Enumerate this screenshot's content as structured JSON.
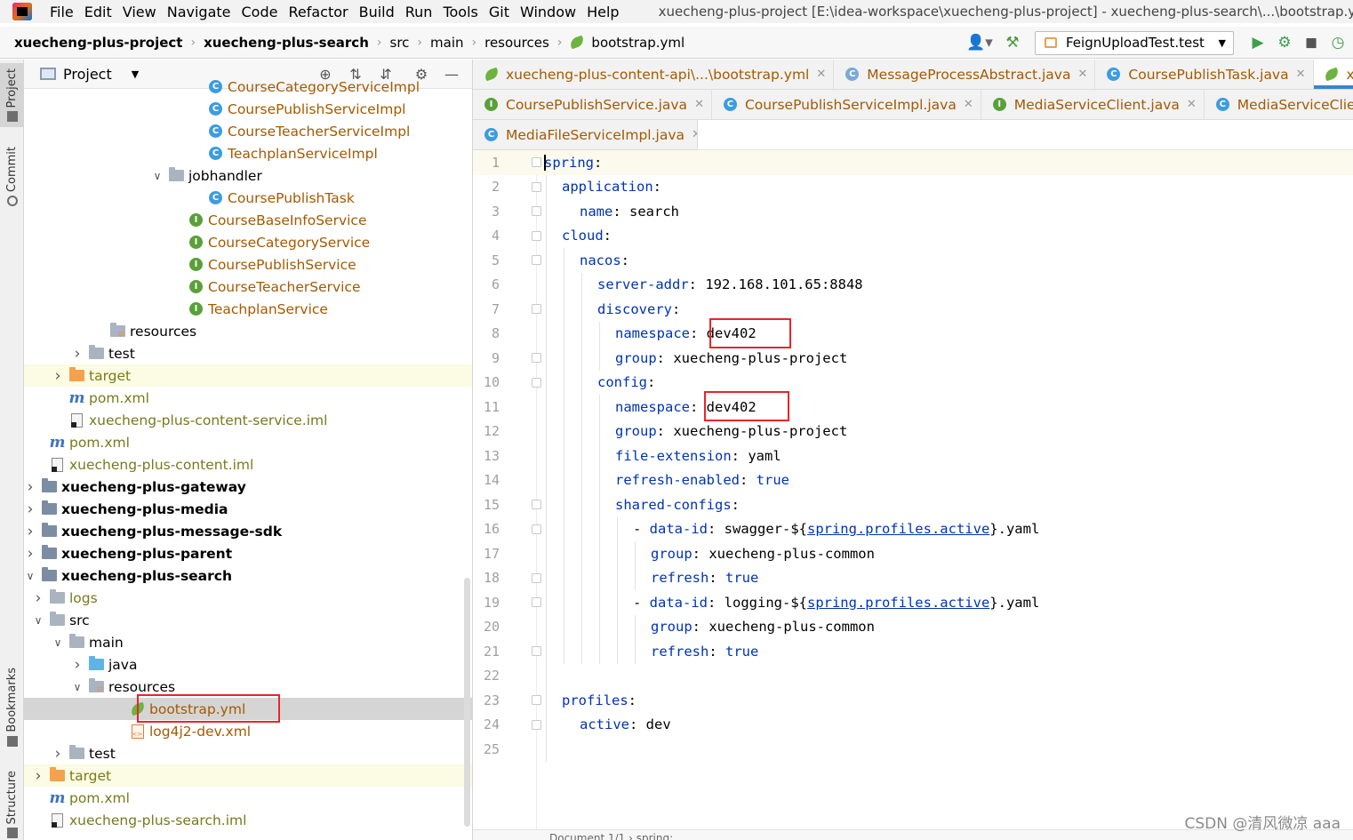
{
  "menu": {
    "items": [
      "File",
      "Edit",
      "View",
      "Navigate",
      "Code",
      "Refactor",
      "Build",
      "Run",
      "Tools",
      "Git",
      "Window",
      "Help"
    ],
    "window_title": "xuecheng-plus-project [E:\\idea-workspace\\xuecheng-plus-project] - xuecheng-plus-search\\...\\bootstrap.yml"
  },
  "navbar": {
    "crumbs": [
      "xuecheng-plus-project",
      "xuecheng-plus-search",
      "src",
      "main",
      "resources",
      "bootstrap.yml"
    ],
    "run_config": "FeignUploadTest.test"
  },
  "left_strip": {
    "project": "Project",
    "commit": "Commit",
    "bookmarks": "Bookmarks",
    "structure": "Structure"
  },
  "project_panel": {
    "title": "Project",
    "tree": [
      {
        "label": "CourseCategoryServiceImpl",
        "icon": "class",
        "indent": 234,
        "style": "cls",
        "chevron": "none"
      },
      {
        "label": "CoursePublishServiceImpl",
        "icon": "class",
        "indent": 234,
        "style": "cls",
        "chevron": "none"
      },
      {
        "label": "CourseTeacherServiceImpl",
        "icon": "class",
        "indent": 234,
        "style": "cls",
        "chevron": "none"
      },
      {
        "label": "TeachplanServiceImpl",
        "icon": "class",
        "indent": 234,
        "style": "cls",
        "chevron": "none"
      },
      {
        "label": "jobhandler",
        "icon": "folder",
        "indent": 190,
        "style": "",
        "chevron": "open"
      },
      {
        "label": "CoursePublishTask",
        "icon": "class",
        "indent": 234,
        "style": "cls",
        "chevron": "none"
      },
      {
        "label": "CourseBaseInfoService",
        "icon": "iface",
        "indent": 212,
        "style": "cls",
        "chevron": "none"
      },
      {
        "label": "CourseCategoryService",
        "icon": "iface",
        "indent": 212,
        "style": "cls",
        "chevron": "none"
      },
      {
        "label": "CoursePublishService",
        "icon": "iface",
        "indent": 212,
        "style": "cls",
        "chevron": "none"
      },
      {
        "label": "CourseTeacherService",
        "icon": "iface",
        "indent": 212,
        "style": "cls",
        "chevron": "none"
      },
      {
        "label": "TeachplanService",
        "icon": "iface",
        "indent": 212,
        "style": "cls",
        "chevron": "none"
      },
      {
        "label": "resources",
        "icon": "res",
        "indent": 124,
        "style": "",
        "chevron": "none"
      },
      {
        "label": "test",
        "icon": "folder",
        "indent": 100,
        "style": "",
        "chevron": "closed"
      },
      {
        "label": "target",
        "icon": "orange",
        "indent": 78,
        "style": "olive",
        "chevron": "closed",
        "row": "yellow"
      },
      {
        "label": "pom.xml",
        "icon": "maven",
        "indent": 78,
        "style": "olive",
        "chevron": "none"
      },
      {
        "label": "xuecheng-plus-content-service.iml",
        "icon": "iml",
        "indent": 78,
        "style": "olive",
        "chevron": "none"
      },
      {
        "label": "pom.xml",
        "icon": "maven",
        "indent": 56,
        "style": "olive",
        "chevron": "none"
      },
      {
        "label": "xuecheng-plus-content.iml",
        "icon": "iml",
        "indent": 56,
        "style": "olive",
        "chevron": "none"
      },
      {
        "label": "xuecheng-plus-gateway",
        "icon": "mod",
        "indent": 34,
        "style": "bold",
        "chevron": "closed"
      },
      {
        "label": "xuecheng-plus-media",
        "icon": "mod",
        "indent": 34,
        "style": "bold",
        "chevron": "closed"
      },
      {
        "label": "xuecheng-plus-message-sdk",
        "icon": "mod",
        "indent": 34,
        "style": "bold",
        "chevron": "closed"
      },
      {
        "label": "xuecheng-plus-parent",
        "icon": "mod",
        "indent": 34,
        "style": "bold",
        "chevron": "closed"
      },
      {
        "label": "xuecheng-plus-search",
        "icon": "mod",
        "indent": 34,
        "style": "bold",
        "chevron": "open"
      },
      {
        "label": "logs",
        "icon": "folder",
        "indent": 56,
        "style": "olive",
        "chevron": "closed"
      },
      {
        "label": "src",
        "icon": "folder",
        "indent": 56,
        "style": "",
        "chevron": "open"
      },
      {
        "label": "main",
        "icon": "folder",
        "indent": 78,
        "style": "",
        "chevron": "open"
      },
      {
        "label": "java",
        "icon": "blue",
        "indent": 100,
        "style": "",
        "chevron": "closed"
      },
      {
        "label": "resources",
        "icon": "res",
        "indent": 100,
        "style": "",
        "chevron": "open"
      },
      {
        "label": "bootstrap.yml",
        "icon": "leaf",
        "indent": 146,
        "style": "orange",
        "chevron": "none",
        "row": "selected"
      },
      {
        "label": "log4j2-dev.xml",
        "icon": "xml",
        "indent": 146,
        "style": "orange",
        "chevron": "none"
      },
      {
        "label": "test",
        "icon": "folder",
        "indent": 78,
        "style": "",
        "chevron": "closed"
      },
      {
        "label": "target",
        "icon": "orange",
        "indent": 56,
        "style": "olive",
        "chevron": "closed",
        "row": "yellow"
      },
      {
        "label": "pom.xml",
        "icon": "maven",
        "indent": 56,
        "style": "olive",
        "chevron": "none"
      },
      {
        "label": "xuecheng-plus-search.iml",
        "icon": "iml",
        "indent": 56,
        "style": "olive",
        "chevron": "none"
      }
    ]
  },
  "tabs": {
    "row1": [
      {
        "label": "xuecheng-plus-content-api\\...\\bootstrap.yml",
        "icon": "leaf"
      },
      {
        "label": "MessageProcessAbstract.java",
        "icon": "abstract"
      },
      {
        "label": "CoursePublishTask.java",
        "icon": "class"
      },
      {
        "label": "xuechen",
        "icon": "leaf",
        "active": true
      }
    ],
    "row2": [
      {
        "label": "CoursePublishService.java",
        "icon": "iface"
      },
      {
        "label": "CoursePublishServiceImpl.java",
        "icon": "class"
      },
      {
        "label": "MediaServiceClient.java",
        "icon": "iface"
      },
      {
        "label": "MediaServiceClientFallbac",
        "icon": "class"
      }
    ],
    "row3": [
      {
        "label": "MediaFileServiceImpl.java",
        "icon": "class"
      }
    ]
  },
  "code_lines": [
    {
      "n": "1",
      "indent": 0,
      "parts": [
        [
          "k",
          "spring"
        ],
        [
          "v",
          ":"
        ]
      ],
      "fold": true
    },
    {
      "n": "2",
      "indent": 1,
      "parts": [
        [
          "k",
          "application"
        ],
        [
          "v",
          ":"
        ]
      ],
      "fold": true
    },
    {
      "n": "3",
      "indent": 2,
      "parts": [
        [
          "k",
          "name"
        ],
        [
          "v",
          ": search"
        ]
      ],
      "fold": "end"
    },
    {
      "n": "4",
      "indent": 1,
      "parts": [
        [
          "k",
          "cloud"
        ],
        [
          "v",
          ":"
        ]
      ],
      "fold": true
    },
    {
      "n": "5",
      "indent": 2,
      "parts": [
        [
          "k",
          "nacos"
        ],
        [
          "v",
          ":"
        ]
      ],
      "fold": true
    },
    {
      "n": "6",
      "indent": 3,
      "parts": [
        [
          "k",
          "server-addr"
        ],
        [
          "v",
          ": 192.168.101.65:8848"
        ]
      ],
      "fold": false
    },
    {
      "n": "7",
      "indent": 3,
      "parts": [
        [
          "k",
          "discovery"
        ],
        [
          "v",
          ":"
        ]
      ],
      "fold": true
    },
    {
      "n": "8",
      "indent": 4,
      "parts": [
        [
          "k",
          "namespace"
        ],
        [
          "v",
          ": dev402"
        ]
      ],
      "fold": false
    },
    {
      "n": "9",
      "indent": 4,
      "parts": [
        [
          "k",
          "group"
        ],
        [
          "v",
          ": xuecheng-plus-project"
        ]
      ],
      "fold": "end"
    },
    {
      "n": "10",
      "indent": 3,
      "parts": [
        [
          "k",
          "config"
        ],
        [
          "v",
          ":"
        ]
      ],
      "fold": true
    },
    {
      "n": "11",
      "indent": 4,
      "parts": [
        [
          "k",
          "namespace"
        ],
        [
          "v",
          ": dev402"
        ]
      ],
      "fold": false
    },
    {
      "n": "12",
      "indent": 4,
      "parts": [
        [
          "k",
          "group"
        ],
        [
          "v",
          ": xuecheng-plus-project"
        ]
      ],
      "fold": false
    },
    {
      "n": "13",
      "indent": 4,
      "parts": [
        [
          "k",
          "file-extension"
        ],
        [
          "v",
          ": yaml"
        ]
      ],
      "fold": false
    },
    {
      "n": "14",
      "indent": 4,
      "parts": [
        [
          "k",
          "refresh-enabled"
        ],
        [
          "v",
          ": "
        ],
        [
          "b",
          "true"
        ]
      ],
      "fold": false
    },
    {
      "n": "15",
      "indent": 4,
      "parts": [
        [
          "k",
          "shared-configs"
        ],
        [
          "v",
          ":"
        ]
      ],
      "fold": true
    },
    {
      "n": "16",
      "indent": 5,
      "parts": [
        [
          "v",
          "- "
        ],
        [
          "k",
          "data-id"
        ],
        [
          "v",
          ": swagger-${"
        ],
        [
          "ref",
          "spring.profiles.active"
        ],
        [
          "v",
          "}.yaml"
        ]
      ],
      "fold": true,
      "dash": true
    },
    {
      "n": "17",
      "indent": 6,
      "parts": [
        [
          "k",
          "group"
        ],
        [
          "v",
          ": xuecheng-plus-common"
        ]
      ],
      "fold": false
    },
    {
      "n": "18",
      "indent": 6,
      "parts": [
        [
          "k",
          "refresh"
        ],
        [
          "v",
          ": "
        ],
        [
          "b",
          "true"
        ]
      ],
      "fold": "end"
    },
    {
      "n": "19",
      "indent": 5,
      "parts": [
        [
          "v",
          "- "
        ],
        [
          "k",
          "data-id"
        ],
        [
          "v",
          ": logging-${"
        ],
        [
          "ref",
          "spring.profiles.active"
        ],
        [
          "v",
          "}.yaml"
        ]
      ],
      "fold": true,
      "dash": true
    },
    {
      "n": "20",
      "indent": 6,
      "parts": [
        [
          "k",
          "group"
        ],
        [
          "v",
          ": xuecheng-plus-common"
        ]
      ],
      "fold": false
    },
    {
      "n": "21",
      "indent": 6,
      "parts": [
        [
          "k",
          "refresh"
        ],
        [
          "v",
          ": "
        ],
        [
          "b",
          "true"
        ]
      ],
      "fold": "end"
    },
    {
      "n": "22",
      "indent": 0,
      "parts": [],
      "fold": false
    },
    {
      "n": "23",
      "indent": 1,
      "parts": [
        [
          "k",
          "profiles"
        ],
        [
          "v",
          ":"
        ]
      ],
      "fold": true
    },
    {
      "n": "24",
      "indent": 2,
      "parts": [
        [
          "k",
          "active"
        ],
        [
          "v",
          ": dev"
        ]
      ],
      "fold": "end"
    },
    {
      "n": "25",
      "indent": 0,
      "parts": [],
      "fold": false
    }
  ],
  "editor_breadcrumb": "Document 1/1  ›  spring:",
  "watermark": "CSDN @清风微凉 aaa"
}
